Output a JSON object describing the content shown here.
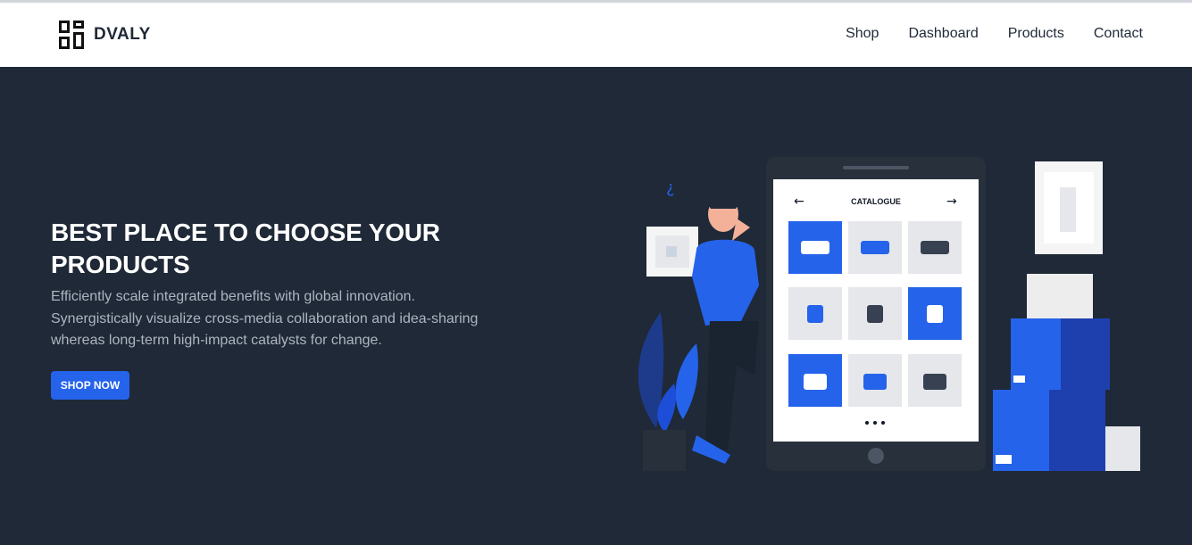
{
  "brand": {
    "name": "DVALY",
    "logo_icon": "grid-logo-icon"
  },
  "nav": {
    "items": [
      {
        "label": "Shop"
      },
      {
        "label": "Dashboard"
      },
      {
        "label": "Products"
      },
      {
        "label": "Contact"
      }
    ]
  },
  "hero": {
    "title": "BEST PLACE TO CHOOSE YOUR PRODUCTS",
    "description": "Efficiently scale integrated benefits with global innovation. Synergistically visualize cross-media collaboration and idea-sharing whereas long-term high-impact catalysts for change.",
    "cta_label": "SHOP NOW"
  },
  "illustration": {
    "catalogue_title": "CATALOGUE",
    "prev_icon": "arrow-left-icon",
    "next_icon": "arrow-right-icon"
  },
  "colors": {
    "accent": "#2563eb",
    "background": "#1f2937",
    "navbar": "#ffffff"
  }
}
